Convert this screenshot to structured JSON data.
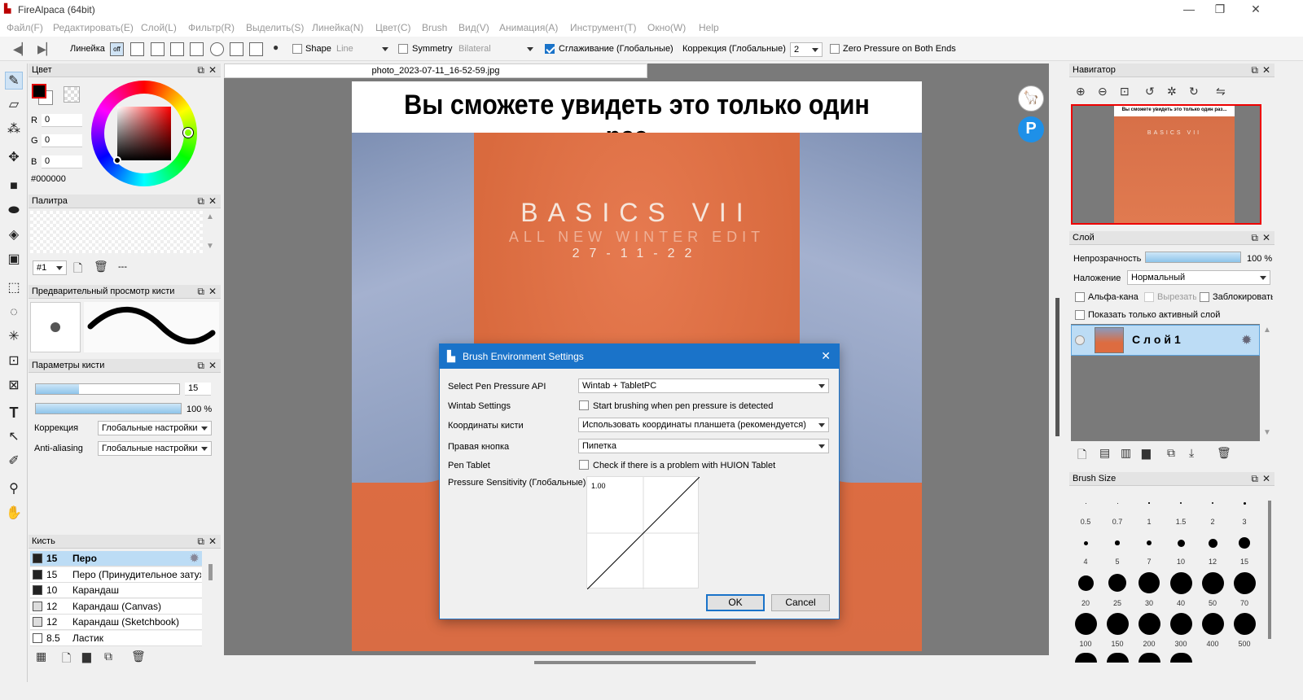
{
  "window": {
    "title": "FireAlpaca (64bit)"
  },
  "menu": [
    "Файл(F)",
    "Редактировать(E)",
    "Слой(L)",
    "Фильтр(R)",
    "Выделить(S)",
    "Линейка(N)",
    "Цвет(C)",
    "Brush",
    "Вид(V)",
    "Анимация(A)",
    "Инструмент(T)",
    "Окно(W)",
    "Help"
  ],
  "toolbar": {
    "ruler_label": "Линейка",
    "ruler_off": "off",
    "shape_label": "Shape",
    "shape_value": "Line",
    "symmetry_label": "Symmetry",
    "symmetry_value": "Bilateral",
    "smoothing_label": "Сглаживание (Глобальные)",
    "correction_label": "Коррекция (Глобальные)",
    "correction_value": "2",
    "zero_pressure_label": "Zero Pressure on Both Ends"
  },
  "color_panel": {
    "title": "Цвет",
    "r_label": "R",
    "r": "0",
    "g_label": "G",
    "g": "0",
    "b_label": "B",
    "b": "0",
    "hex": "#000000",
    "fg_color": "#000000"
  },
  "palette_panel": {
    "title": "Палитра",
    "index": "#1",
    "dash": "---"
  },
  "brush_preview": {
    "title": "Предварительный просмотр кисти"
  },
  "brush_params": {
    "title": "Параметры кисти",
    "size": "15",
    "size_fraction": 0.3,
    "opacity": "100 %",
    "opacity_fraction": 1.0,
    "correction_label": "Коррекция",
    "correction_value": "Глобальные настройки",
    "aa_label": "Anti-aliasing",
    "aa_value": "Глобальные настройки"
  },
  "brush_list": {
    "title": "Кисть",
    "rows": [
      {
        "size": "15",
        "name": "Перо",
        "color": "#222222"
      },
      {
        "size": "15",
        "name": "Перо (Принудительное затухание)",
        "color": "#222222"
      },
      {
        "size": "10",
        "name": "Карандаш",
        "color": "#222222"
      },
      {
        "size": "12",
        "name": "Карандаш (Canvas)",
        "color": "#dddddd"
      },
      {
        "size": "12",
        "name": "Карандаш (Sketchbook)",
        "color": "#dddddd"
      },
      {
        "size": "8.5",
        "name": "Ластик",
        "color": "#ffffff"
      }
    ]
  },
  "document": {
    "tab": "photo_2023-07-11_16-52-59.jpg",
    "caption": "Вы сможете увидеть это только один раз...",
    "image_title": "BASICS VII",
    "image_subtitle": "ALL NEW WINTER EDIT",
    "image_date": "27-11-22"
  },
  "dialog": {
    "title": "Brush Environment Settings",
    "pen_api_label": "Select Pen Pressure API",
    "pen_api_value": "Wintab + TabletPC",
    "wintab_label": "Wintab Settings",
    "wintab_check": "Start brushing when pen pressure is detected",
    "coords_label": "Координаты кисти",
    "coords_value": "Использовать координаты планшета (рекомендуется)",
    "right_btn_label": "Правая кнопка",
    "right_btn_value": "Пипетка",
    "pen_tablet_label": "Pen Tablet",
    "pen_tablet_check": "Check if there is a problem with HUION Tablet",
    "sensitivity_label": "Pressure Sensitivity (Глобальные)",
    "curve_value": "1.00",
    "ok": "OK",
    "cancel": "Cancel"
  },
  "navigator": {
    "title": "Навигатор",
    "thumb_caption": "Вы сможете увидеть это только один раз...",
    "thumb_title": "BASICS VII"
  },
  "layer_panel": {
    "title": "Слой",
    "opacity_label": "Непрозрачность",
    "opacity_value": "100 %",
    "blend_label": "Наложение",
    "blend_value": "Нормальный",
    "alpha_label": "Альфа-канал",
    "clip_label": "Вырезать",
    "lock_label": "Заблокировать",
    "show_active_label": "Показать только активный слой",
    "layer_name": "Слой1"
  },
  "brush_size": {
    "title": "Brush Size",
    "sizes": [
      "0.5",
      "0.7",
      "1",
      "1.5",
      "2",
      "3",
      "4",
      "5",
      "7",
      "10",
      "12",
      "15",
      "20",
      "25",
      "30",
      "40",
      "50",
      "70",
      "100",
      "150",
      "200",
      "300",
      "400",
      "500"
    ]
  }
}
